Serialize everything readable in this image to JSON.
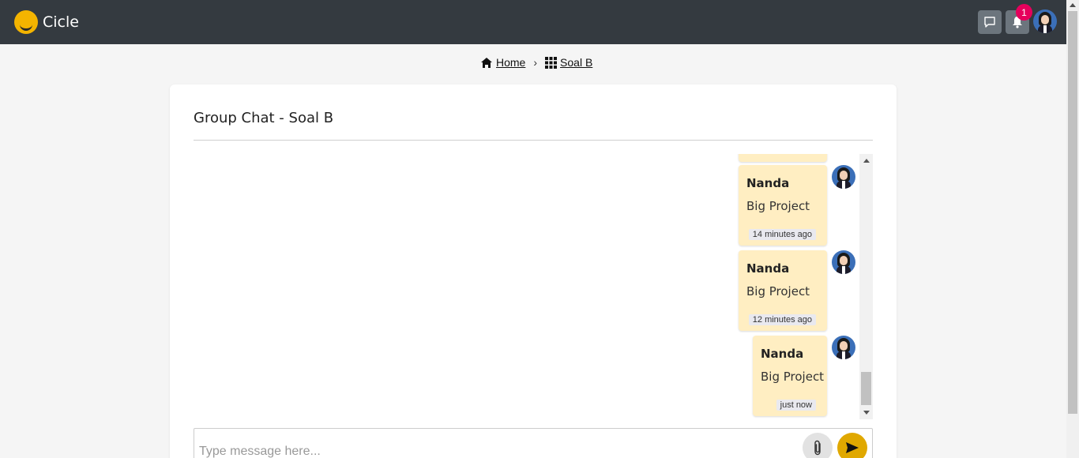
{
  "app": {
    "name": "Cicle"
  },
  "header": {
    "notification_count": "1",
    "icons": [
      "chat-icon",
      "bell-icon",
      "user-avatar"
    ]
  },
  "breadcrumb": {
    "home": "Home",
    "current": "Soal B",
    "separator": "›"
  },
  "chat": {
    "title": "Group Chat - Soal B",
    "messages": [
      {
        "sender": "Nanda",
        "text": "Big Project",
        "time": "14 minutes ago"
      },
      {
        "sender": "Nanda",
        "text": "Big Project",
        "time": "12 minutes ago"
      },
      {
        "sender": "Nanda",
        "text": "Big Project",
        "time": "just now"
      }
    ],
    "input": {
      "placeholder": "Type message here..."
    }
  },
  "colors": {
    "topbar": "#343a40",
    "bubble": "#ffeec2",
    "send": "#e0a800",
    "badge": "#e6005c"
  }
}
